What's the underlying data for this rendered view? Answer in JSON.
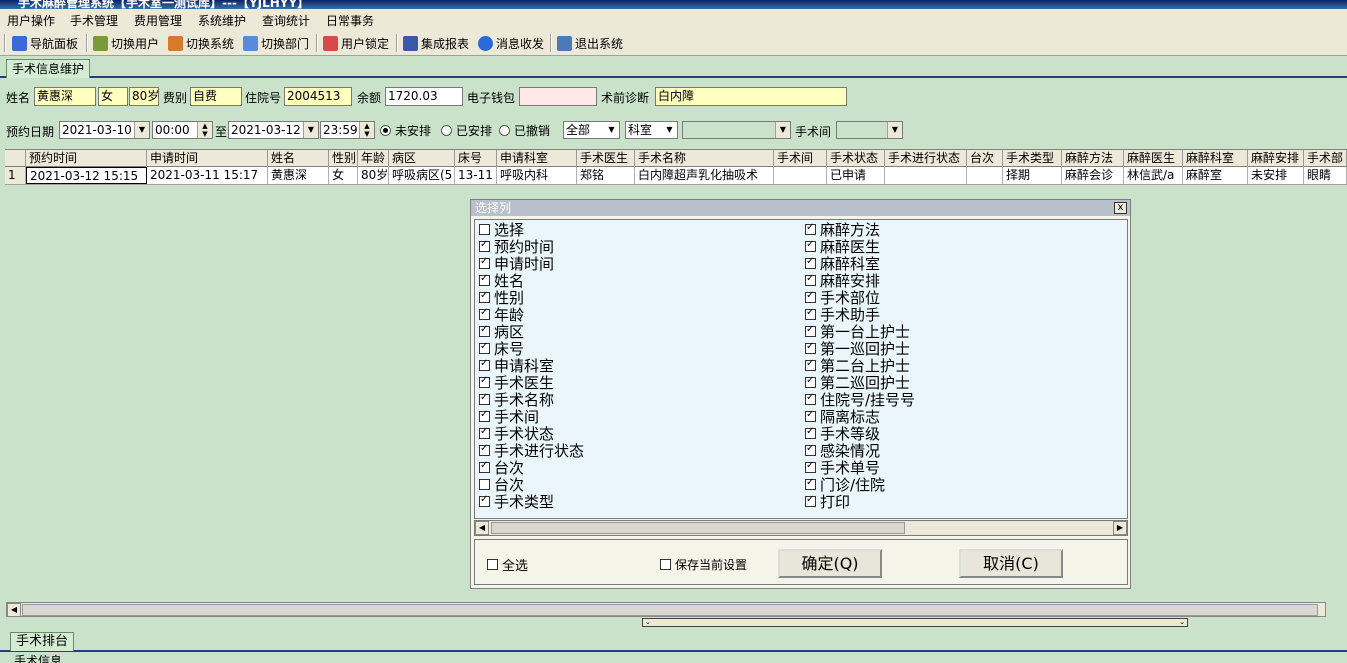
{
  "window": {
    "title": "手术麻醉管理系统【手术室一测试库】---【YJLHYY】"
  },
  "menu": [
    "用户操作",
    "手术管理",
    "费用管理",
    "系统维护",
    "查询统计",
    "日常事务"
  ],
  "toolbar": [
    {
      "label": "导航面板",
      "icon": "navigation-panel-icon",
      "color": "#3a6ad8"
    },
    {
      "label": "切换用户",
      "icon": "switch-user-icon",
      "color": "#7a9a3a"
    },
    {
      "label": "切换系统",
      "icon": "switch-system-icon",
      "color": "#d87a2a"
    },
    {
      "label": "切换部门",
      "icon": "switch-department-icon",
      "color": "#5a8ad8"
    },
    {
      "label": "用户锁定",
      "icon": "user-lock-icon",
      "color": "#d84a4a"
    },
    {
      "label": "集成报表",
      "icon": "report-icon",
      "color": "#3a5aa8"
    },
    {
      "label": "消息收发",
      "icon": "message-icon",
      "color": "#2a6ad8"
    },
    {
      "label": "退出系统",
      "icon": "exit-icon",
      "color": "#4a7ab8"
    }
  ],
  "tabs": {
    "top": "手术信息维护",
    "bottom": "手术排台"
  },
  "patient": {
    "name_label": "姓名",
    "name": "黄惠深",
    "sex": "女",
    "age": "80岁",
    "fee_type_label": "费别",
    "fee_type": "自费",
    "inpatient_no_label": "住院号",
    "inpatient_no": "2004513",
    "balance_label": "余额",
    "balance": "1720.03",
    "wallet_label": "电子钱包",
    "wallet": "",
    "diagnosis_label": "术前诊断",
    "diagnosis": "白内障"
  },
  "filter": {
    "date_label": "预约日期",
    "date_from": "2021-03-10",
    "time_from": "00:00",
    "to_label": "至",
    "date_to": "2021-03-12",
    "time_to": "23:59",
    "radios": [
      {
        "label": "未安排",
        "checked": true
      },
      {
        "label": "已安排",
        "checked": false
      },
      {
        "label": "已撤销",
        "checked": false
      }
    ],
    "status_select": "全部",
    "dept_select": "科室",
    "dept_value": "",
    "room_label": "手术间",
    "room_value": ""
  },
  "grid": {
    "columns": [
      "预约时间",
      "申请时间",
      "姓名",
      "性别",
      "年龄",
      "病区",
      "床号",
      "申请科室",
      "手术医生",
      "手术名称",
      "手术间",
      "手术状态",
      "手术进行状态",
      "台次",
      "手术类型",
      "麻醉方法",
      "麻醉医生",
      "麻醉科室",
      "麻醉安排",
      "手术部"
    ],
    "rows": [
      [
        "1",
        "2021-03-12 15:15",
        "2021-03-11 15:17",
        "黄惠深",
        "女",
        "80岁",
        "呼吸病区(5",
        "13-11",
        "呼吸内科",
        "郑铭",
        "白内障超声乳化抽吸术",
        "",
        "已申请",
        "",
        "",
        "择期",
        "麻醉会诊",
        "林信武/a",
        "麻醉室",
        "未安排",
        "眼睛"
      ]
    ]
  },
  "dialog": {
    "title": "选择列",
    "close": "x",
    "left_items": [
      {
        "label": "选择",
        "checked": false
      },
      {
        "label": "预约时间",
        "checked": true
      },
      {
        "label": "申请时间",
        "checked": true
      },
      {
        "label": "姓名",
        "checked": true
      },
      {
        "label": "性别",
        "checked": true
      },
      {
        "label": "年龄",
        "checked": true
      },
      {
        "label": "病区",
        "checked": true
      },
      {
        "label": "床号",
        "checked": true
      },
      {
        "label": "申请科室",
        "checked": true
      },
      {
        "label": "手术医生",
        "checked": true
      },
      {
        "label": "手术名称",
        "checked": true
      },
      {
        "label": "手术间",
        "checked": true
      },
      {
        "label": "手术状态",
        "checked": true
      },
      {
        "label": "手术进行状态",
        "checked": true
      },
      {
        "label": "台次",
        "checked": true
      },
      {
        "label": "台次",
        "checked": false
      },
      {
        "label": "手术类型",
        "checked": true
      }
    ],
    "right_items": [
      {
        "label": "麻醉方法",
        "checked": true
      },
      {
        "label": "麻醉医生",
        "checked": true
      },
      {
        "label": "麻醉科室",
        "checked": true
      },
      {
        "label": "麻醉安排",
        "checked": true
      },
      {
        "label": "手术部位",
        "checked": true
      },
      {
        "label": "手术助手",
        "checked": true
      },
      {
        "label": "第一台上护士",
        "checked": true
      },
      {
        "label": "第一巡回护士",
        "checked": true
      },
      {
        "label": "第二台上护士",
        "checked": true
      },
      {
        "label": "第二巡回护士",
        "checked": true
      },
      {
        "label": "住院号/挂号号",
        "checked": true
      },
      {
        "label": "隔离标志",
        "checked": true
      },
      {
        "label": "手术等级",
        "checked": true
      },
      {
        "label": "感染情况",
        "checked": true
      },
      {
        "label": "手术单号",
        "checked": true
      },
      {
        "label": "门诊/住院",
        "checked": true
      },
      {
        "label": "打印",
        "checked": true
      }
    ],
    "select_all_label": "全选",
    "save_settings_label": "保存当前设置",
    "ok_label": "确定(Q)",
    "cancel_label": "取消(C)"
  },
  "bottom": {
    "info_label": "手术信息"
  }
}
